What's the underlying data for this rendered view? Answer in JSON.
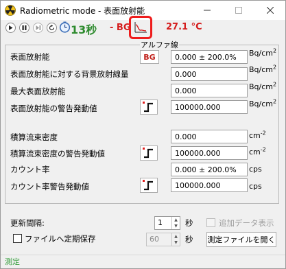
{
  "window": {
    "title": "Radiometric mode - 表面放射能",
    "app_icon": "radiation-icon",
    "controls": [
      "minimize-icon",
      "maximize-icon",
      "close-icon"
    ]
  },
  "toolbar": {
    "buttons": [
      "play-icon",
      "pause-icon",
      "skip-icon",
      "reset-icon",
      "timer-clock-icon"
    ],
    "timer": "13秒",
    "bg_label": "- BG",
    "bg_graph_icon": "bg-graph-icon",
    "temperature": "27.1 °C"
  },
  "panel": {
    "group_label": "アルファ線",
    "rows": [
      {
        "label": "表面放射能",
        "value": "0.000 ± 200.0%",
        "unit_base": "Bq/cm",
        "unit_exp": "2"
      },
      {
        "label": "表面放射能に対する背景放射線量",
        "value": "0.000",
        "unit_base": "Bq/cm",
        "unit_exp": "2"
      },
      {
        "label": "最大表面放射能",
        "value": "0.000",
        "unit_base": "Bq/cm",
        "unit_exp": "2"
      },
      {
        "label": "表面放射能の警告発動値",
        "value": "100000.000",
        "unit_base": "Bq/cm",
        "unit_exp": "2"
      },
      {
        "label": "積算流束密度",
        "value": "0.000",
        "unit_base": "cm",
        "unit_exp": "-2"
      },
      {
        "label": "積算流束密度の警告発動値",
        "value": "100000.000",
        "unit_base": "cm",
        "unit_exp": "-2"
      },
      {
        "label": "カウント率",
        "value": "0.000 ± 200.0%",
        "unit_base": "cps",
        "unit_exp": ""
      },
      {
        "label": "カウント率警告発動値",
        "value": "100000.000",
        "unit_base": "cps",
        "unit_exp": ""
      }
    ],
    "bg_button_label": "BG",
    "alarm_icon": "alarm-threshold-icon"
  },
  "settings": {
    "update_interval_label": "更新間隔:",
    "update_interval_value": "1",
    "update_interval_unit": "秒",
    "add_data_label": "追加データ表示",
    "periodic_save_label": "ファイルへ定期保存",
    "save_interval_value": "60",
    "save_interval_unit": "秒",
    "open_file_button": "測定ファイルを開く"
  },
  "status": {
    "text": "測定"
  },
  "colors": {
    "timer_green": "#2e8b2e",
    "alert_red": "#d41c1c",
    "highlight_box": "#ee1c1c",
    "status_green": "#3aa040"
  }
}
